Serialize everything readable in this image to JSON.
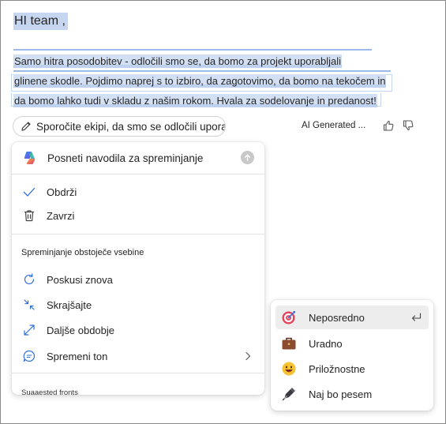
{
  "document": {
    "greeting": "HI team ,",
    "paragraph_lines": [
      "Samo hitra posodobitev - odločili smo se, da bomo za projekt uporabljali",
      "glinene skodle. Pojdimo naprej s to izbiro, da zagotovimo, da bomo na tekočem in",
      "da bomo lahko tudi v skladu z našim rokom. Hvala za sodelovanje in predanost!"
    ]
  },
  "prompt": {
    "text": "Sporočite ekipi, da smo se odločili uporabiti ...",
    "ai_generated_label": "AI Generated ..."
  },
  "menu": {
    "header_placeholder": "Posneti navodila za spreminjanje",
    "actions": [
      {
        "label": "Obdrži",
        "icon": "checkmark-icon"
      },
      {
        "label": "Zavrzi",
        "icon": "trash-icon"
      }
    ],
    "section_title": "Spreminjanje obstoječe vsebine",
    "modify_items": [
      {
        "label": "Poskusi znova",
        "icon": "retry-icon"
      },
      {
        "label": "Skrajšajte",
        "icon": "shorten-icon"
      },
      {
        "label": "Daljše obdobje",
        "icon": "lengthen-icon"
      },
      {
        "label": "Spremeni ton",
        "icon": "chat-tone-icon"
      }
    ],
    "cutoff_label": "Suaaested fronts"
  },
  "tone_submenu": {
    "items": [
      {
        "label": "Neposredno",
        "icon": "target-icon",
        "selected": true
      },
      {
        "label": "Uradno",
        "icon": "briefcase-icon",
        "selected": false
      },
      {
        "label": "Priložnostne",
        "icon": "smiley-icon",
        "selected": false
      },
      {
        "label": "Naj bo pesem",
        "icon": "fountain-pen-icon",
        "selected": false
      }
    ]
  },
  "colors": {
    "selection_highlight": "#d3e0f4",
    "selection_underline": "#9bbbea",
    "hover_background": "#ededed",
    "accent_blue": "#2f6fd6"
  }
}
